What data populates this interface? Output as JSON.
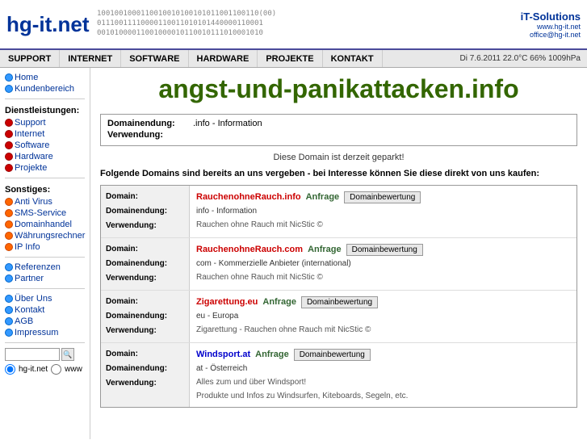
{
  "header": {
    "logo": "hg-it.net",
    "it_solutions": "iT-Solutions",
    "website": "www.hg-it.net",
    "email": "office@hg-it.net",
    "binary_lines": [
      "1001001000110010010100101011001100110(00)",
      "0111001111000011001101010144000011000..01",
      "001010000110010000101100101110100010..."
    ]
  },
  "navbar": {
    "items": [
      "Support",
      "Internet",
      "Software",
      "Hardware",
      "Projekte",
      "Kontakt"
    ],
    "datetime": "Di 7.6.2011  22.0°C  66%  1009hPa"
  },
  "sidebar": {
    "nav_header": "",
    "items_main": [
      {
        "label": "Home",
        "color": "blue"
      },
      {
        "label": "Kundenbereich",
        "color": "blue"
      }
    ],
    "dienstleistungen_header": "Dienstleistungen:",
    "items_dienst": [
      {
        "label": "Support",
        "color": "red"
      },
      {
        "label": "Internet",
        "color": "red"
      },
      {
        "label": "Software",
        "color": "red"
      },
      {
        "label": "Hardware",
        "color": "red"
      },
      {
        "label": "Projekte",
        "color": "red"
      }
    ],
    "sonstiges_header": "Sonstiges:",
    "items_sonstiges": [
      {
        "label": "Anti Virus",
        "color": "orange"
      },
      {
        "label": "SMS-Service",
        "color": "orange"
      },
      {
        "label": "Domainhandel",
        "color": "orange"
      },
      {
        "label": "Währungsrechner",
        "color": "orange"
      },
      {
        "label": "IP Info",
        "color": "orange"
      }
    ],
    "items_referenz": [
      {
        "label": "Referenzen",
        "color": "blue"
      },
      {
        "label": "Partner",
        "color": "blue"
      }
    ],
    "items_info": [
      {
        "label": "Über Uns",
        "color": "blue"
      },
      {
        "label": "Kontakt",
        "color": "blue"
      },
      {
        "label": "AGB",
        "color": "blue"
      },
      {
        "label": "Impressum",
        "color": "blue"
      }
    ],
    "search_placeholder": "",
    "radio_hgit": "hg-it.net",
    "radio_www": "www"
  },
  "content": {
    "page_title": "angst-und-panikattacken.info",
    "domain_info": {
      "endung_label": "Domainendung:",
      "endung_val": ".info - Information",
      "verwendung_label": "Verwendung:",
      "verwendung_val": ""
    },
    "parked_notice": "Diese Domain ist derzeit geparkt!",
    "domains_intro": "Folgende Domains sind bereits an uns vergeben - bei Interesse können Sie diese direkt von uns kaufen:",
    "domains": [
      {
        "domain_label": "Domain:",
        "endung_label": "Domainendung:",
        "verwendung_label": "Verwendung:",
        "name_part1": "Rauchen",
        "name_bold1": "ohne",
        "name_bold2": "Rauch",
        "name_part2": ".info",
        "anfrage": "Anfrage",
        "btn": "Domainbewertung",
        "endung_val": "info - Information",
        "verwendung_val": "Rauchen ohne Rauch mit NicStic ©"
      },
      {
        "domain_label": "Domain:",
        "endung_label": "Domainendung:",
        "verwendung_label": "Verwendung:",
        "name_part1": "Rauchen",
        "name_bold1": "ohne",
        "name_bold2": "Rauch",
        "name_part2": ".com",
        "anfrage": "Anfrage",
        "btn": "Domainbewertung",
        "endung_val": "com - Kommerzielle Anbieter (international)",
        "verwendung_val": "Rauchen ohne Rauch mit NicStic ©"
      },
      {
        "domain_label": "Domain:",
        "endung_label": "Domainendung:",
        "verwendung_label": "Verwendung:",
        "name_part1": "Zigarettung",
        "name_bold1": "",
        "name_bold2": "",
        "name_part2": ".eu",
        "anfrage": "Anfrage",
        "btn": "Domainbewertung",
        "endung_val": "eu - Europa",
        "verwendung_val": "Zigarettung - Rauchen ohne Rauch mit NicStic ©"
      },
      {
        "domain_label": "Domain:",
        "endung_label": "Domainendung:",
        "verwendung_label": "Verwendung:",
        "name_part1": "Windsport",
        "name_bold1": "",
        "name_bold2": "",
        "name_part2": ".at",
        "anfrage": "Anfrage",
        "btn": "Domainbewertung",
        "endung_val": "at - Österreich",
        "verwendung_val1": "Alles zum und über Windsport!",
        "verwendung_val2": "Produkte und Infos zu Windsurfen, Kiteboards, Segeln, etc."
      }
    ]
  }
}
